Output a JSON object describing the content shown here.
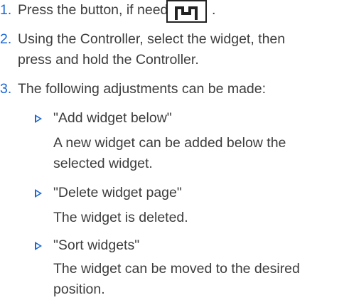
{
  "steps": [
    {
      "number": "1.",
      "text": "Press the button, if needed",
      "icon": "home-button-icon",
      "trailing": "."
    },
    {
      "number": "2.",
      "lines": [
        "Using the Controller, select the widget, then",
        "press and hold the Controller."
      ]
    },
    {
      "number": "3.",
      "text": "The following adjustments can be made:"
    }
  ],
  "options": [
    {
      "label": "\"Add widget below\"",
      "description": [
        "A new widget can be added below the",
        "selected widget."
      ]
    },
    {
      "label": "\"Delete widget page\"",
      "description": [
        "The widget is deleted."
      ]
    },
    {
      "label": "\"Sort widgets\"",
      "description": [
        "The widget can be moved to the desired",
        "position."
      ]
    }
  ],
  "colors": {
    "accent": "#1c69d4",
    "text": "#3d3d3d"
  }
}
